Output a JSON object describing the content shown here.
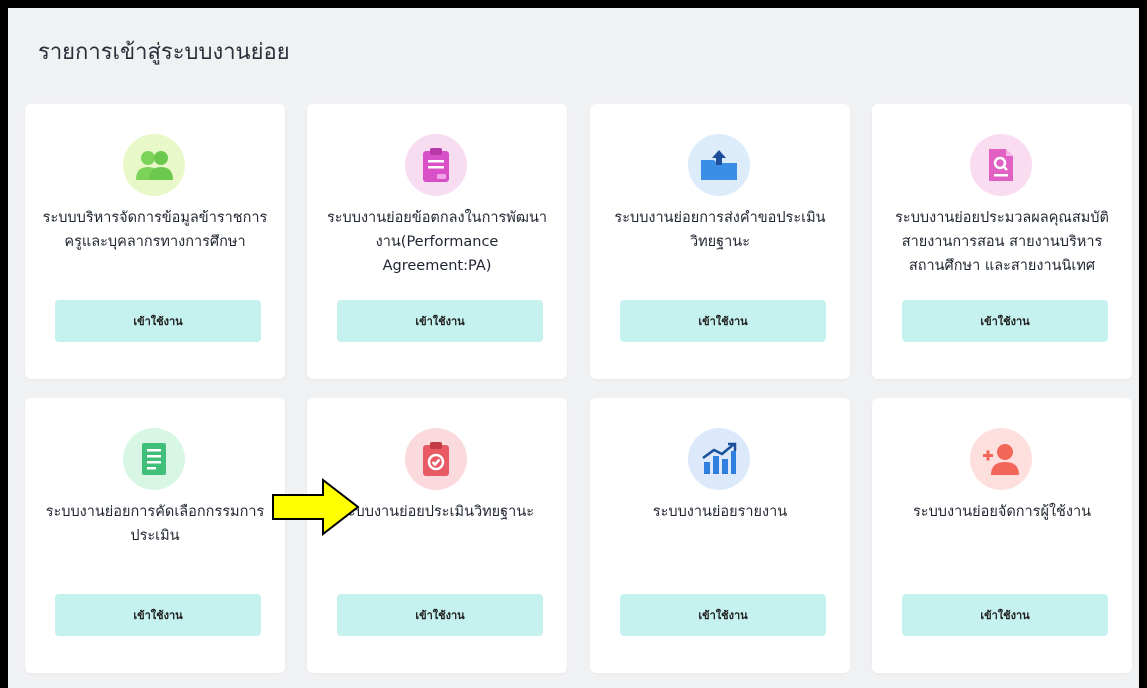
{
  "page": {
    "title": "รายการเข้าสู่ระบบงานย่อย"
  },
  "cards": [
    {
      "title": "ระบบบริหารจัดการข้อมูลข้าราชการครูและบุคลากรทางการศึกษา",
      "button_label": "เข้าใช้งาน",
      "icon": "people-icon",
      "icon_bg": "#e9f8c9",
      "icon_color": "#7cd35a"
    },
    {
      "title": "ระบบงานย่อยข้อตกลงในการพัฒนางาน(Performance Agreement:PA)",
      "button_label": "เข้าใช้งาน",
      "icon": "clipboard-pa-icon",
      "icon_bg": "#f7dcf2",
      "icon_color": "#d94fc8"
    },
    {
      "title": "ระบบงานย่อยการส่งคำขอประเมินวิทยฐานะ",
      "button_label": "เข้าใช้งาน",
      "icon": "folder-upload-icon",
      "icon_bg": "#dcecfb",
      "icon_color": "#3a8ee6"
    },
    {
      "title": "ระบบงานย่อยประมวลผลคุณสมบัติสายงานการสอน สายงานบริหารสถานศึกษา และสายงานนิเทศ",
      "button_label": "เข้าใช้งาน",
      "icon": "document-search-icon",
      "icon_bg": "#fadcf1",
      "icon_color": "#e060c4"
    },
    {
      "title": "ระบบงานย่อยการคัดเลือกกรรมการประเมิน",
      "button_label": "เข้าใช้งาน",
      "icon": "document-list-icon",
      "icon_bg": "#d8f6e4",
      "icon_color": "#3fbf7a"
    },
    {
      "title": "ระบบงานย่อยประเมินวิทยฐานะ",
      "button_label": "เข้าใช้งาน",
      "icon": "clipboard-check-icon",
      "icon_bg": "#fbdadd",
      "icon_color": "#e85a64"
    },
    {
      "title": "ระบบงานย่อยรายงาน",
      "button_label": "เข้าใช้งาน",
      "icon": "bar-chart-icon",
      "icon_bg": "#dce9fb",
      "icon_color": "#2f7fe0"
    },
    {
      "title": "ระบบงานย่อยจัดการผู้ใช้งาน",
      "button_label": "เข้าใช้งาน",
      "icon": "add-user-icon",
      "icon_bg": "#fde0de",
      "icon_color": "#f2665a"
    }
  ],
  "annotation": {
    "arrow_color": "#ffff00",
    "arrow_stroke": "#000000"
  }
}
